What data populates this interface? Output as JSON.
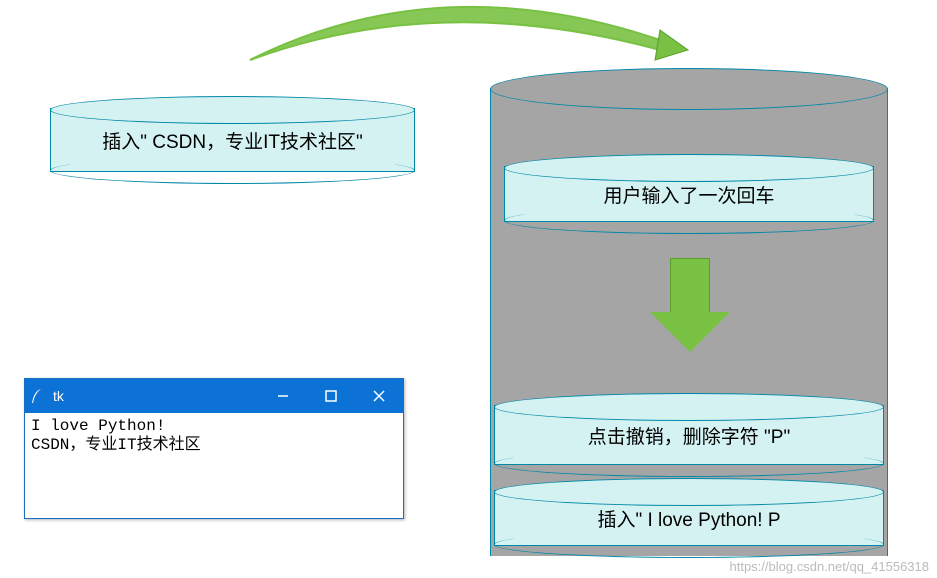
{
  "left_cyl": {
    "label": "插入\" CSDN，专业IT技术社区\""
  },
  "stack": {
    "item1": "用户输入了一次回车",
    "item2": "点击撤销，删除字符 \"P\"",
    "item3": "插入\" I love Python! P"
  },
  "tk": {
    "title": "tk",
    "line1": "I love Python!",
    "line2": "CSDN，专业IT技术社区"
  },
  "watermark": "https://blog.csdn.net/qq_41556318",
  "colors": {
    "cyl_fill": "#d5f2f2",
    "cyl_stroke": "#0088a8",
    "gray_fill": "#a5a5a5",
    "arrow_green": "#79c143",
    "tk_title": "#0d72d6"
  }
}
